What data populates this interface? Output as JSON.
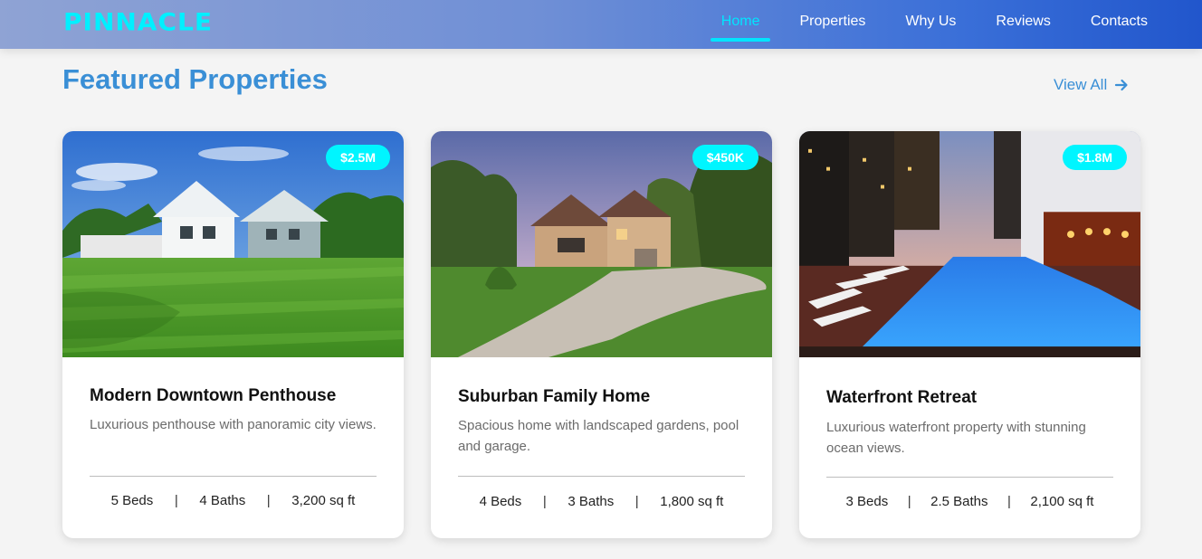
{
  "brand": {
    "logo_text": "PINNACLE"
  },
  "nav": {
    "items": [
      {
        "label": "Home",
        "active": true
      },
      {
        "label": "Properties",
        "active": false
      },
      {
        "label": "Why Us",
        "active": false
      },
      {
        "label": "Reviews",
        "active": false
      },
      {
        "label": "Contacts",
        "active": false
      }
    ]
  },
  "section": {
    "title": "Featured Properties",
    "view_all_label": "View All",
    "view_all_icon": "arrow-right-icon"
  },
  "properties": [
    {
      "price": "$2.5M",
      "title": "Modern Downtown Penthouse",
      "description": "Luxurious penthouse with panoramic city views.",
      "beds": "5 Beds",
      "baths": "4 Baths",
      "area": "3,200 sq ft",
      "separator": "|"
    },
    {
      "price": "$450K",
      "title": "Suburban Family Home",
      "description": "Spacious home with landscaped gardens, pool and garage.",
      "beds": "4 Beds",
      "baths": "3 Baths",
      "area": "1,800 sq ft",
      "separator": "|"
    },
    {
      "price": "$1.8M",
      "title": "Waterfront Retreat",
      "description": "Luxurious waterfront property with stunning ocean views.",
      "beds": "3 Beds",
      "baths": "2.5 Baths",
      "area": "2,100 sq ft",
      "separator": "|"
    }
  ],
  "colors": {
    "accent": "#00e5ff",
    "heading": "#3a8fd6",
    "header_gradient_start": "#8fa3d4",
    "header_gradient_end": "#2156cc"
  }
}
